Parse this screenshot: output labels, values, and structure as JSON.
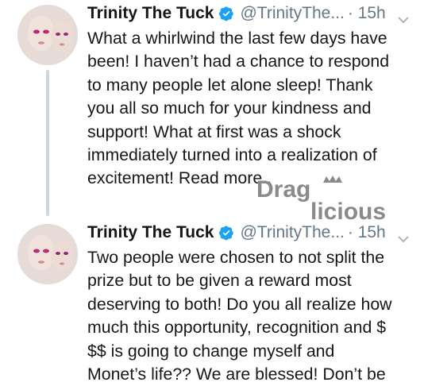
{
  "tweets": [
    {
      "name": "Trinity The Tuck",
      "handle": "@TrinityThe...",
      "time": "· 15h",
      "lines": [
        "What a whirlwind the last few days have",
        "been! I haven’t had a chance to respond",
        "to many people let alone sleep! Thank",
        "you all so much for your kindness and",
        "support! What at first was a shock",
        "immediately turned into a realization of",
        "excitement! Read more.."
      ]
    },
    {
      "name": "Trinity The Tuck",
      "handle": "@TrinityThe...",
      "time": "· 15h",
      "lines": [
        "Two people were chosen to not split the",
        "prize but to be given a reward most",
        "deserving to both! Do you all realize how",
        "much this opportunity, recognition and $",
        "$$ is going to change myself and",
        "Monet’s life?? We are blessed! Don’t be"
      ]
    }
  ],
  "watermark": {
    "text_top": "Drag",
    "text_bottom": "licious"
  },
  "icons": {
    "verified": "verified-badge-icon",
    "caret": "chevron-down-icon"
  },
  "colors": {
    "verified_blue": "#1da1f2",
    "secondary_text": "#657786",
    "thread_line": "#ccd6dd",
    "watermark_gray": "#8a8a8a"
  }
}
